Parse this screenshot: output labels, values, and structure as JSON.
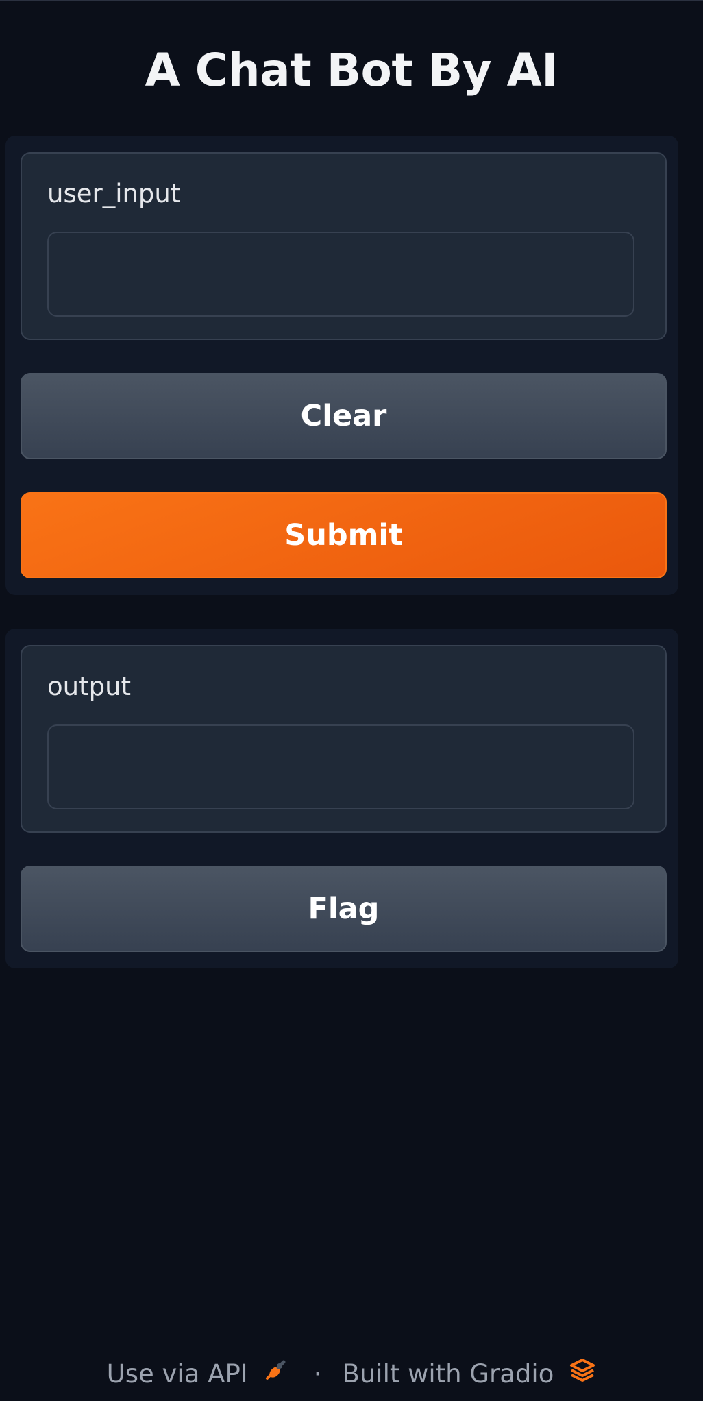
{
  "title": "A Chat Bot By AI",
  "input_panel": {
    "label": "user_input",
    "value": "",
    "placeholder": "",
    "clear_label": "Clear",
    "submit_label": "Submit"
  },
  "output_panel": {
    "label": "output",
    "value": "",
    "flag_label": "Flag"
  },
  "footer": {
    "api_label": "Use via API",
    "separator": "·",
    "built_label": "Built with Gradio",
    "api_icon": "rocket-icon",
    "gradio_icon": "gradio-logo-icon"
  },
  "colors": {
    "background": "#0b0f19",
    "panel": "#111827",
    "block": "#1f2937",
    "primary": "#f97316",
    "secondary": "#4b5563"
  }
}
